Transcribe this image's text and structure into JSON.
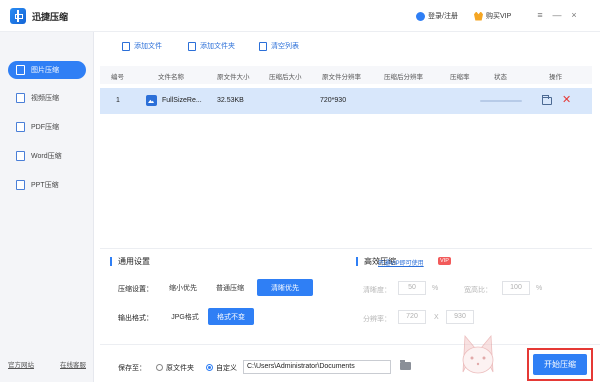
{
  "app": {
    "title": "迅捷压缩"
  },
  "header": {
    "login_label": "登录/注册",
    "vip_label": "购买VIP",
    "controls": [
      "≡",
      "—",
      "×"
    ]
  },
  "sidebar": {
    "items": [
      {
        "label": "图片压缩",
        "icon": "image-icon",
        "active": true
      },
      {
        "label": "视频压缩",
        "icon": "video-icon",
        "active": false
      },
      {
        "label": "PDF压缩",
        "icon": "pdf-icon",
        "active": false
      },
      {
        "label": "Word压缩",
        "icon": "word-icon",
        "active": false
      },
      {
        "label": "PPT压缩",
        "icon": "ppt-icon",
        "active": false
      }
    ],
    "footer_links": [
      "官方网站",
      "在线客服"
    ]
  },
  "toolbar": {
    "add_file": "添加文件",
    "add_folder": "添加文件夹",
    "clear_list": "清空列表"
  },
  "table": {
    "columns": [
      "编号",
      "文件名称",
      "原文件大小",
      "压缩后大小",
      "原文件分辨率",
      "压缩后分辨率",
      "压缩率",
      "状态",
      "操作"
    ],
    "rows": [
      {
        "index": "1",
        "name": "FullSizeRe...",
        "orig_size": "32.53KB",
        "comp_size": "",
        "orig_res": "720*930",
        "comp_res": "",
        "ratio": "",
        "status": ""
      }
    ]
  },
  "settings": {
    "general_title": "通用设置",
    "compress_label": "压缩设置：",
    "compress_options": [
      "缩小优先",
      "普通压缩",
      "清晰优先"
    ],
    "compress_selected": "清晰优先",
    "output_label": "输出格式：",
    "output_options": [
      "JPG格式",
      "格式不变"
    ],
    "output_selected": "格式不变",
    "hq_title": "高效压缩",
    "vip_link": "开通VIP即可使用",
    "vip_badge": "VIP",
    "clarity_label": "清晰度：",
    "clarity_value": "50",
    "clarity_unit": "%",
    "width_ratio_label": "宽高比：",
    "width_ratio_value": "100",
    "width_ratio_unit": "%",
    "resolution_label": "分辨率：",
    "res_w": "720",
    "res_x": "X",
    "res_h": "930"
  },
  "bottom": {
    "save_label": "保存至：",
    "radio_original": "原文件夹",
    "radio_custom": "自定义",
    "path_value": "C:\\Users\\Administrator\\Documents",
    "start_button": "开始压缩"
  },
  "colors": {
    "accent": "#2f7ff5",
    "highlight": "#e53935",
    "row_selected": "#d8e7fb"
  }
}
